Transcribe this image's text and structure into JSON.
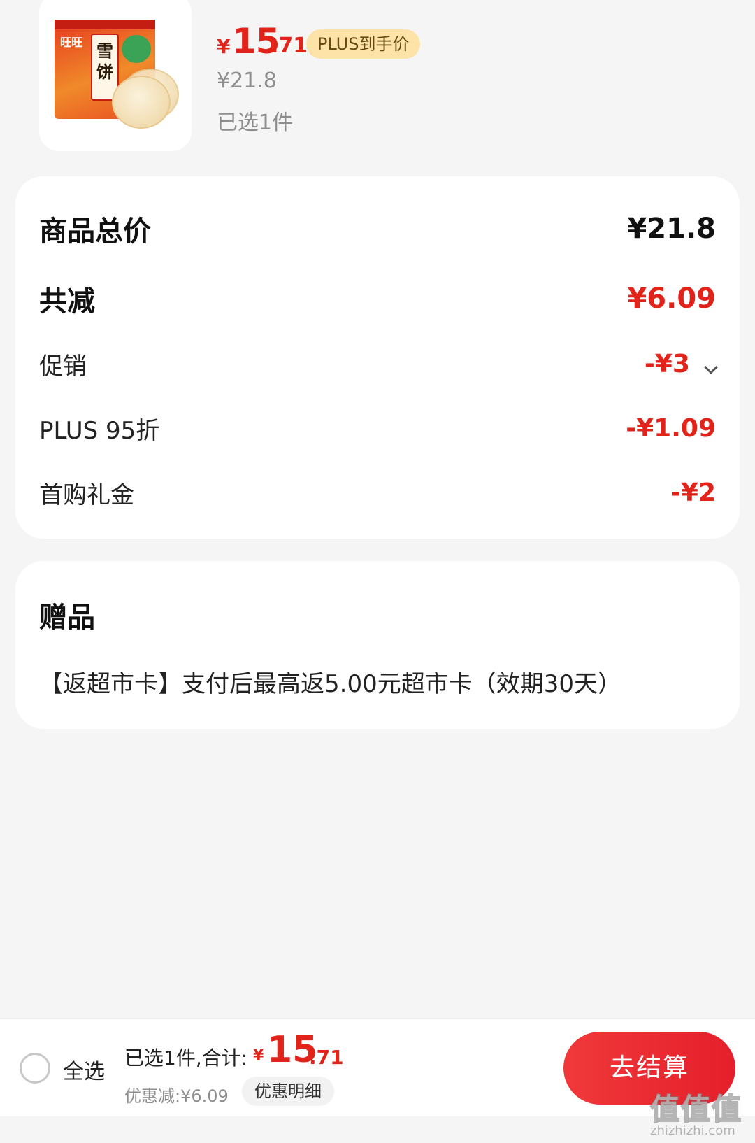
{
  "product": {
    "image_icon": "rice-cracker-pack-image",
    "brand_text": "旺旺",
    "pack_text": "雪饼",
    "price_yen": "¥",
    "price_int": "15",
    "price_dec": ".71",
    "plus_badge": "PLUS到手价",
    "original_price": "¥21.8",
    "selected_count": "已选1件"
  },
  "price_breakdown": {
    "total_label": "商品总价",
    "total_value": "¥21.8",
    "reduced_label": "共减",
    "reduced_value": "¥6.09",
    "items": [
      {
        "label": "促销",
        "value": "-¥3"
      },
      {
        "label": "PLUS 95折",
        "value": "-¥1.09"
      },
      {
        "label": "首购礼金",
        "value": "-¥2"
      }
    ]
  },
  "gift": {
    "title": "赠品",
    "text": "【返超市卡】支付后最高返5.00元超市卡（效期30天）"
  },
  "bottom_bar": {
    "select_all": "全选",
    "total_label": "已选1件,合计:",
    "total_yen": "¥",
    "total_int": "15",
    "total_dec": ".71",
    "discount": "优惠减:¥6.09",
    "detail_button": "优惠明细",
    "checkout_button": "去结算"
  },
  "watermark": {
    "main": "值值值",
    "sub": "zhizhizhi.com"
  },
  "colors": {
    "accent_red": "#e2231a",
    "plus_badge_bg": "#fde3a7",
    "background": "#f5f5f5"
  }
}
